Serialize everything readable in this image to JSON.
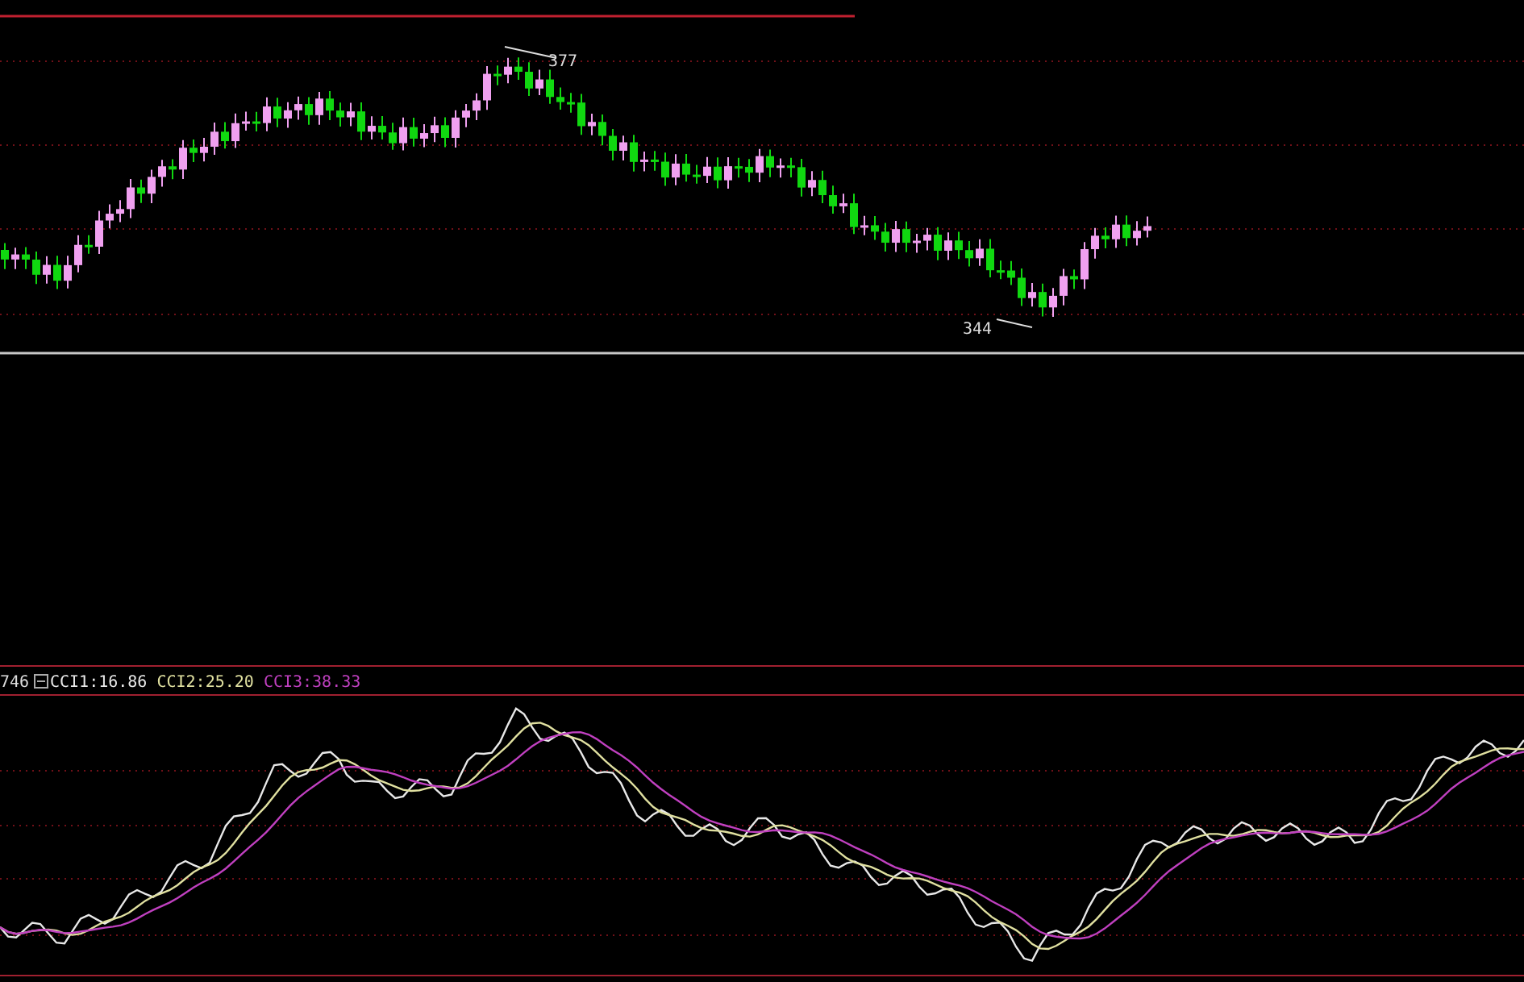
{
  "price_panel": {
    "high_label": "377",
    "low_label": "344"
  },
  "indicator_panel": {
    "value_label": "746",
    "legend": [
      {
        "text": "CCI1:16.86",
        "color": "#e8e8e8"
      },
      {
        "text": "CCI2:25.20",
        "color": "#e0e0a0"
      },
      {
        "text": "CCI3:38.33",
        "color": "#c040c0"
      }
    ]
  }
}
